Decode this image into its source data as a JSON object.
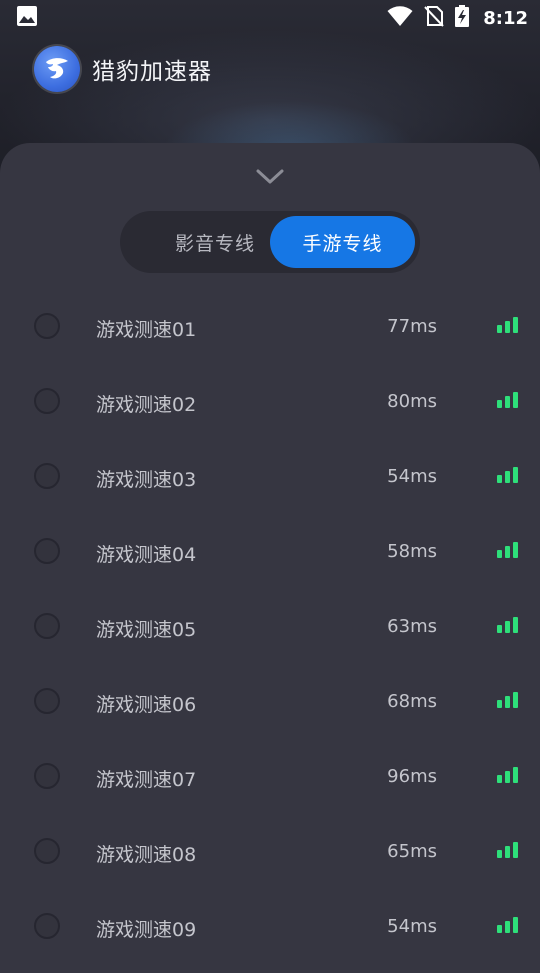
{
  "status_bar": {
    "time": "8:12",
    "icons": [
      "image-notification-icon",
      "wifi-icon",
      "no-sim-icon",
      "battery-charging-icon"
    ]
  },
  "app": {
    "title": "猎豹加速器",
    "logo_icon": "cheetah-logo-icon"
  },
  "panel": {
    "collapse_icon": "chevron-down-icon",
    "tabs": [
      {
        "label": "影音专线",
        "active": false
      },
      {
        "label": "手游专线",
        "active": true
      }
    ],
    "servers": [
      {
        "name": "游戏测速01",
        "latency": "77ms",
        "signal": "signal-strong-icon"
      },
      {
        "name": "游戏测速02",
        "latency": "80ms",
        "signal": "signal-strong-icon"
      },
      {
        "name": "游戏测速03",
        "latency": "54ms",
        "signal": "signal-strong-icon"
      },
      {
        "name": "游戏测速04",
        "latency": "58ms",
        "signal": "signal-strong-icon"
      },
      {
        "name": "游戏测速05",
        "latency": "63ms",
        "signal": "signal-strong-icon"
      },
      {
        "name": "游戏测速06",
        "latency": "68ms",
        "signal": "signal-strong-icon"
      },
      {
        "name": "游戏测速07",
        "latency": "96ms",
        "signal": "signal-strong-icon"
      },
      {
        "name": "游戏测速08",
        "latency": "65ms",
        "signal": "signal-strong-icon"
      },
      {
        "name": "游戏测速09",
        "latency": "54ms",
        "signal": "signal-strong-icon"
      }
    ]
  },
  "colors": {
    "accent": "#1677e5",
    "signal": "#2ee07a",
    "panel_bg": "#363641",
    "page_bg": "#1f2029"
  }
}
